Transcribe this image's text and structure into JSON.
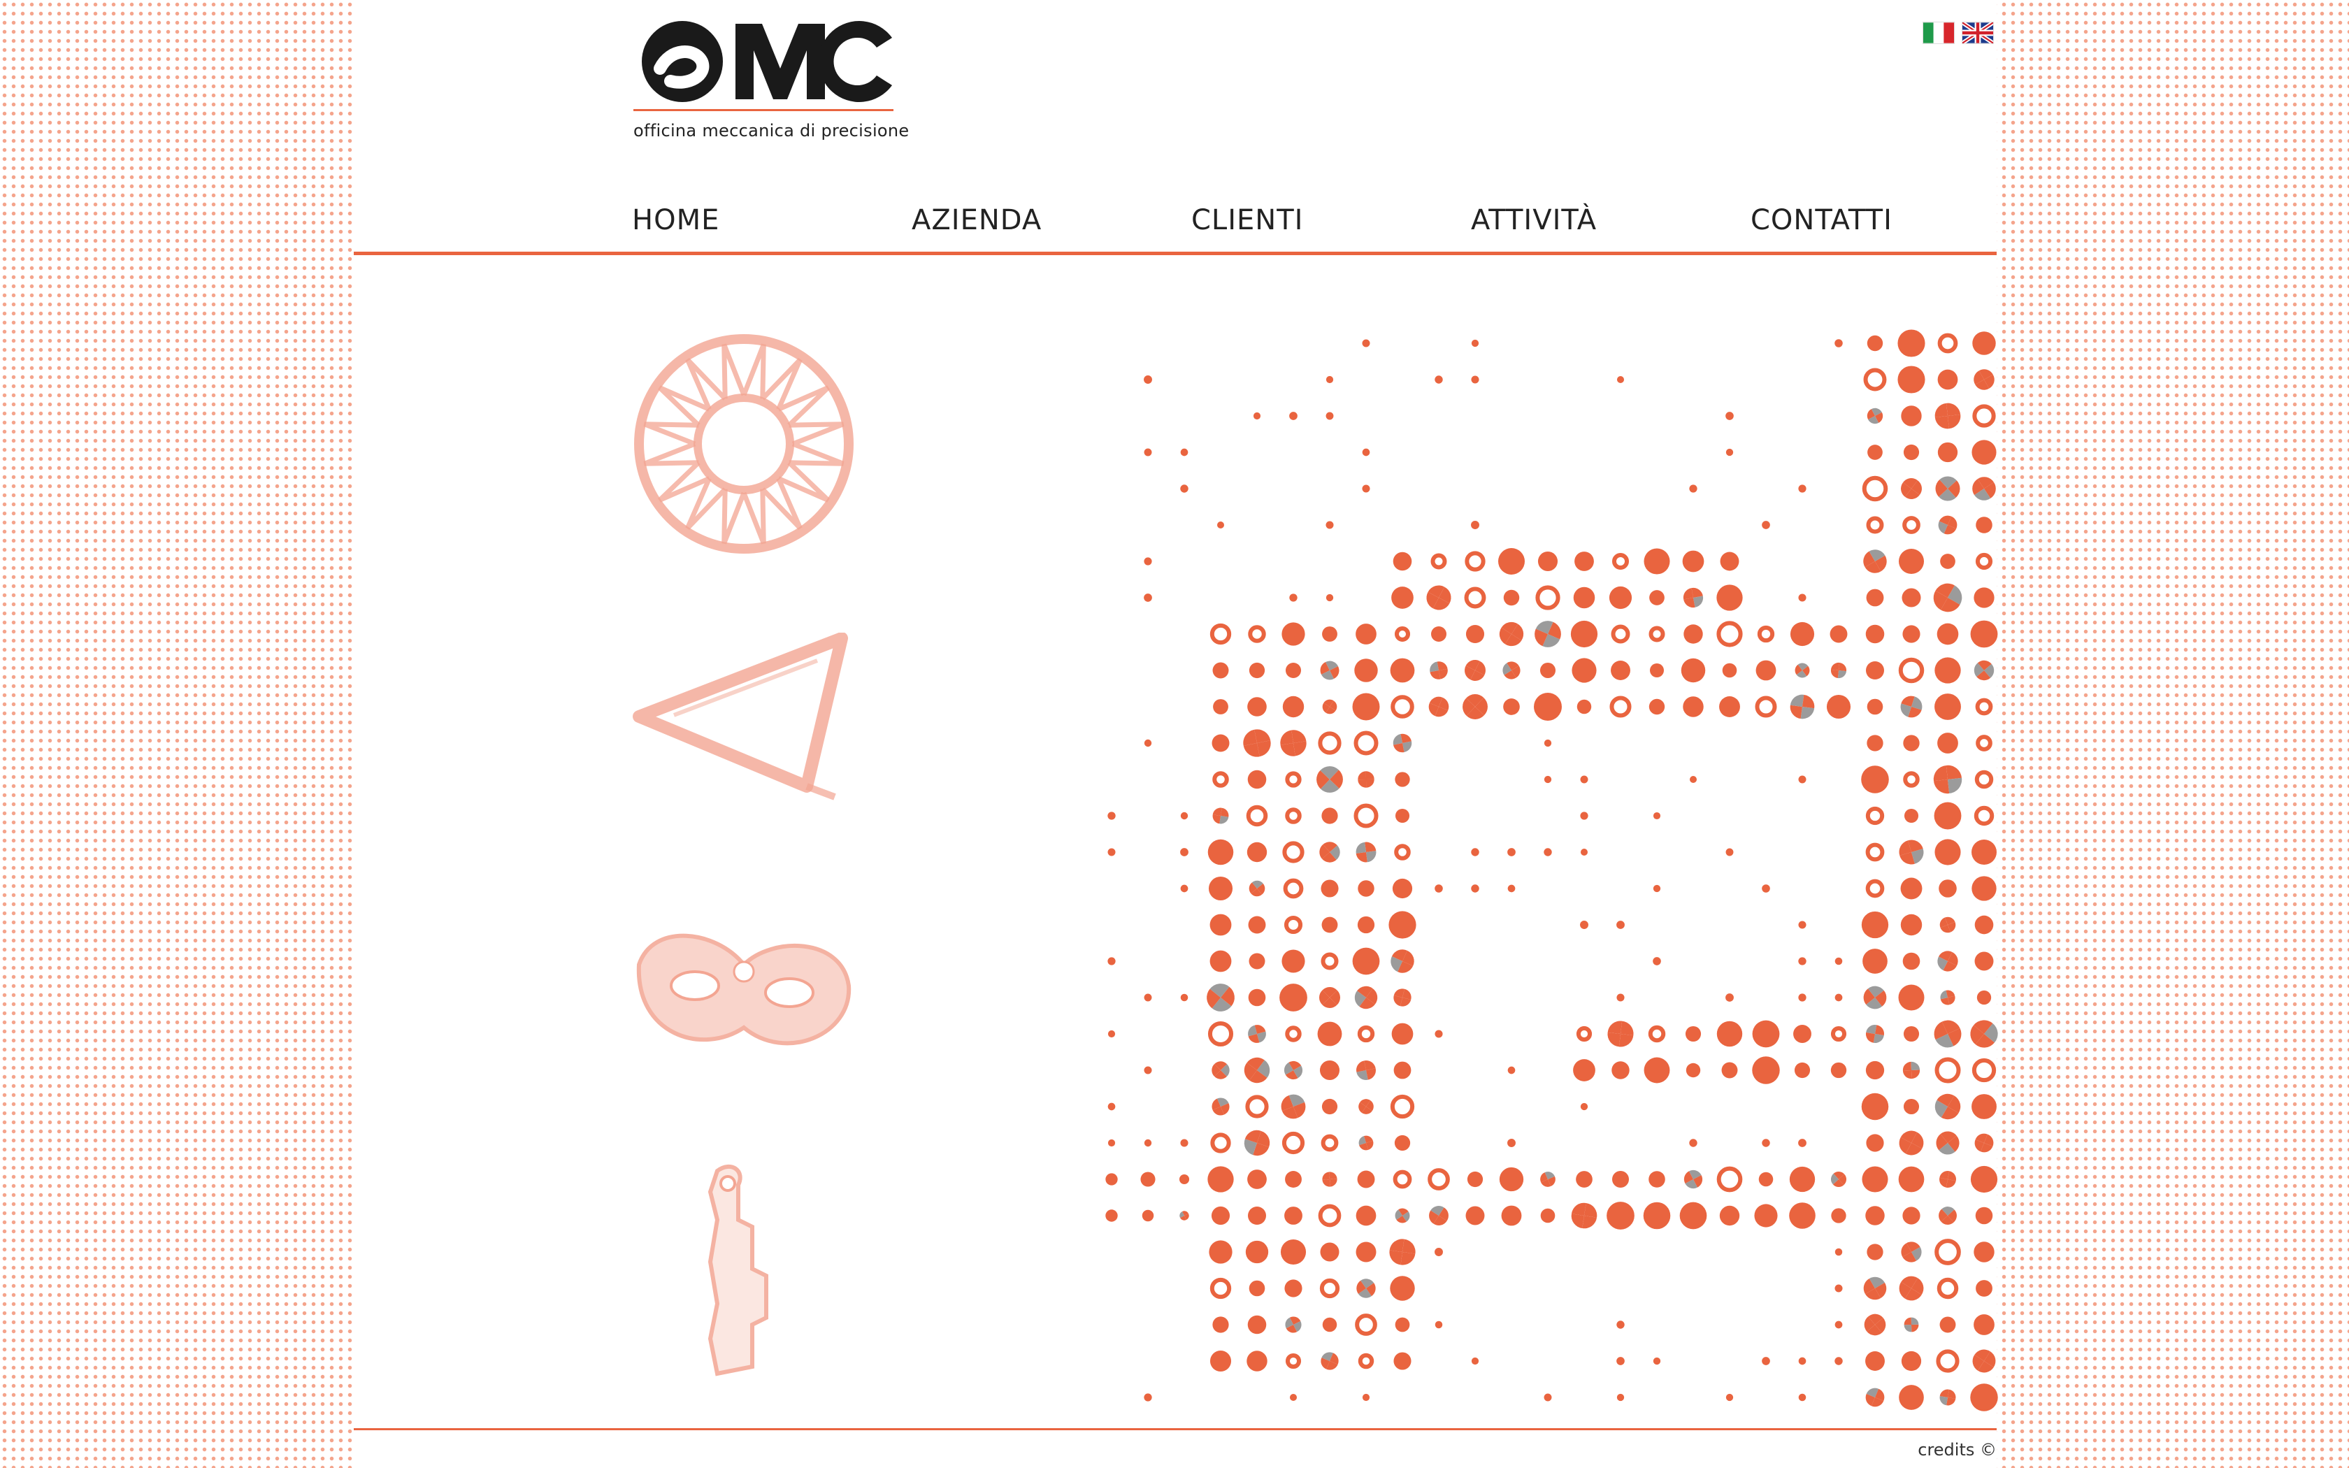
{
  "brand": {
    "logo_text": "OMC",
    "tagline": "officina meccanica di precisione"
  },
  "languages": [
    {
      "name": "italian-flag-icon",
      "code": "it"
    },
    {
      "name": "english-flag-icon",
      "code": "en"
    }
  ],
  "nav": {
    "items": [
      "HOME",
      "AZIENDA",
      "CLIENTI",
      "ATTIVITÀ",
      "CONTATTI"
    ]
  },
  "parts": [
    {
      "name": "gear-ring-part-icon"
    },
    {
      "name": "bracket-part-icon"
    },
    {
      "name": "mask-part-icon"
    },
    {
      "name": "shaft-part-icon"
    }
  ],
  "decoration": {
    "name": "dotted-pattern-graphic",
    "accent": "#e9643f",
    "secondary": "#9b9b9b"
  },
  "footer": {
    "credits": "credits ©"
  },
  "colors": {
    "accent": "#e9643f",
    "text": "#222222",
    "background_dots": "#f4a48c"
  }
}
